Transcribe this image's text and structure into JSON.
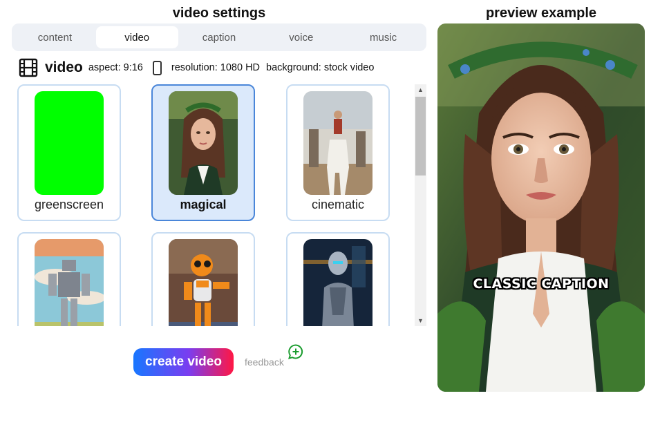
{
  "settings": {
    "title": "video settings"
  },
  "preview": {
    "title": "preview example",
    "caption": "CLASSIC CAPTION"
  },
  "tabs": [
    {
      "label": "content",
      "active": false
    },
    {
      "label": "video",
      "active": true
    },
    {
      "label": "caption",
      "active": false
    },
    {
      "label": "voice",
      "active": false
    },
    {
      "label": "music",
      "active": false
    }
  ],
  "info": {
    "title": "video",
    "aspect": "aspect: 9:16",
    "resolution": "resolution: 1080 HD",
    "background": "background: stock video"
  },
  "styles": [
    {
      "label": "greenscreen",
      "selected": false
    },
    {
      "label": "magical",
      "selected": true
    },
    {
      "label": "cinematic",
      "selected": false
    },
    {
      "label": "",
      "selected": false
    },
    {
      "label": "",
      "selected": false
    },
    {
      "label": "",
      "selected": false
    }
  ],
  "actions": {
    "create_label": "create video",
    "feedback_label": "feedback"
  },
  "colors": {
    "greenscreen": "#00ff00",
    "selected_border": "#4a86d9",
    "card_border": "#c7dcf2",
    "feedback_icon": "#1a9c2e"
  },
  "icons": {
    "film": "film-icon",
    "aspect": "phone-outline-icon",
    "feedback": "chat-plus-icon"
  }
}
